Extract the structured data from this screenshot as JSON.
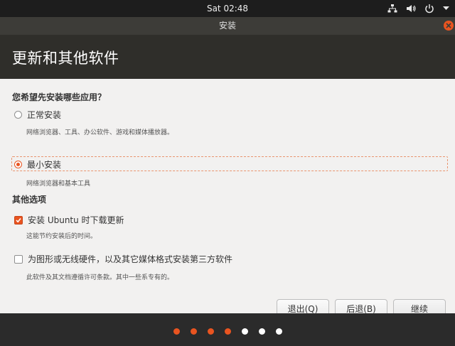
{
  "topbar": {
    "clock": "Sat 02:48",
    "icons": [
      "network-icon",
      "volume-icon",
      "power-icon",
      "chevron-down-icon"
    ]
  },
  "window": {
    "title": "安装",
    "header_title": "更新和其他软件"
  },
  "install_question": {
    "label": "您希望先安装哪些应用？",
    "options": [
      {
        "label": "正常安装",
        "description": "网络浏览器、工具、办公软件、游戏和媒体播放器。",
        "selected": false
      },
      {
        "label": "最小安装",
        "description": "网络浏览器和基本工具",
        "selected": true
      }
    ]
  },
  "other_options": {
    "label": "其他选项",
    "items": [
      {
        "label": "安装 Ubuntu 时下载更新",
        "description": "这能节约安装后的时间。",
        "checked": true
      },
      {
        "label": "为图形或无线硬件，以及其它媒体格式安装第三方软件",
        "description": "此软件及其文档遵循许可条款。其中一些系专有的。",
        "checked": false
      }
    ]
  },
  "buttons": {
    "quit": "退出(Q)",
    "back": "后退(B)",
    "continue": "继续"
  },
  "progress": {
    "total_steps": 7,
    "completed_steps": 4,
    "colors": {
      "done": "#e95420",
      "pending": "#ffffff"
    }
  },
  "colors": {
    "accent": "#e95420",
    "header_bg": "#2f2e2a",
    "content_bg": "#f2f1f0"
  }
}
